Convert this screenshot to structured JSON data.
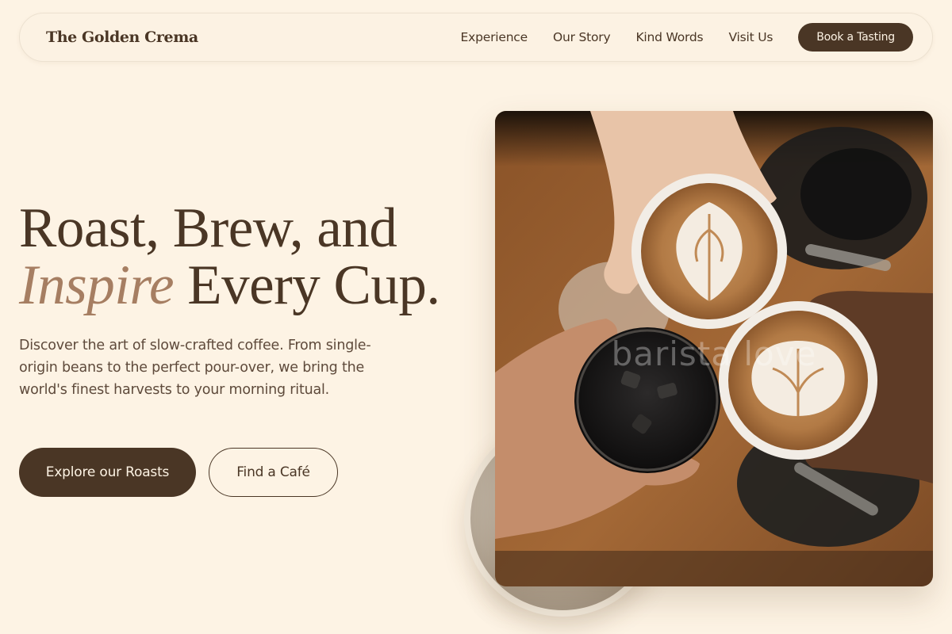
{
  "nav": {
    "brand": "The Golden Crema",
    "links": [
      "Experience",
      "Our Story",
      "Kind Words",
      "Visit Us"
    ],
    "cta": "Book a Tasting"
  },
  "hero": {
    "headline_line1": "Roast, Brew, and",
    "headline_accent": "Inspire",
    "headline_line2_rest": " Every Cup.",
    "lead": "Discover the art of slow-crafted coffee. From single-origin beans to the perfect pour-over, we bring the world's finest harvests to your morning ritual.",
    "primary_button": "Explore our Roasts",
    "secondary_button": "Find a Café"
  },
  "image": {
    "watermark": "barista love"
  },
  "colors": {
    "background": "#fdf3e4",
    "brand_brown": "#4a3625",
    "accent": "#a67e62"
  }
}
